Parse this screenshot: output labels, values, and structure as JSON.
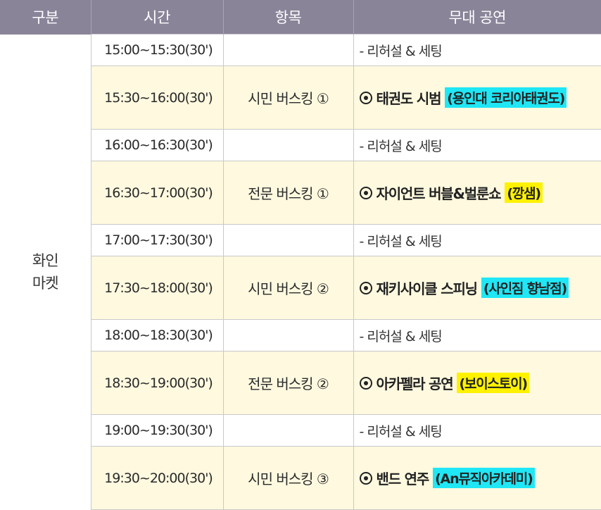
{
  "headers": {
    "category": "구분",
    "time": "시간",
    "item": "항목",
    "stage": "무대 공연"
  },
  "category_label_line1": "화인",
  "category_label_line2": "마켓",
  "colors": {
    "header_bg": "#8a8499",
    "performance_row_bg": "#fef9df",
    "highlight_cyan": "#1fe7f5",
    "highlight_yellow": "#fff200"
  },
  "rows": [
    {
      "time": "15:00~15:30(30')",
      "item": "",
      "stage": "- 리허설 & 세팅"
    },
    {
      "time": "15:30~16:00(30')",
      "item": "시민 버스킹 ①",
      "act": "태권도 시범",
      "performer": "(용인대 코리아태권도)",
      "highlight": "cyan",
      "icon": "circled-dot-bullet-icon"
    },
    {
      "time": "16:00~16:30(30')",
      "item": "",
      "stage": "- 리허설 & 세팅"
    },
    {
      "time": "16:30~17:00(30')",
      "item": "전문 버스킹 ①",
      "act": "자이언트 버블&벌룬쇼",
      "performer": "(깡샘)",
      "highlight": "yellow",
      "icon": "circled-dot-bullet-icon"
    },
    {
      "time": "17:00~17:30(30')",
      "item": "",
      "stage": "- 리허설 & 세팅"
    },
    {
      "time": "17:30~18:00(30')",
      "item": "시민 버스킹 ②",
      "act": "재키사이클 스피닝",
      "performer": "(사인짐 향남점)",
      "highlight": "cyan",
      "icon": "circled-dot-bullet-icon"
    },
    {
      "time": "18:00~18:30(30')",
      "item": "",
      "stage": "- 리허설 & 세팅"
    },
    {
      "time": "18:30~19:00(30')",
      "item": "전문 버스킹 ②",
      "act": "아카펠라 공연",
      "performer": "(보이스토이)",
      "highlight": "yellow",
      "icon": "circled-dot-bullet-icon"
    },
    {
      "time": "19:00~19:30(30')",
      "item": "",
      "stage": "- 리허설 & 세팅"
    },
    {
      "time": "19:30~20:00(30')",
      "item": "시민 버스킹 ③",
      "act": "밴드 연주",
      "performer": "(An뮤직아카데미)",
      "highlight": "cyan",
      "icon": "circled-dot-bullet-icon"
    }
  ]
}
